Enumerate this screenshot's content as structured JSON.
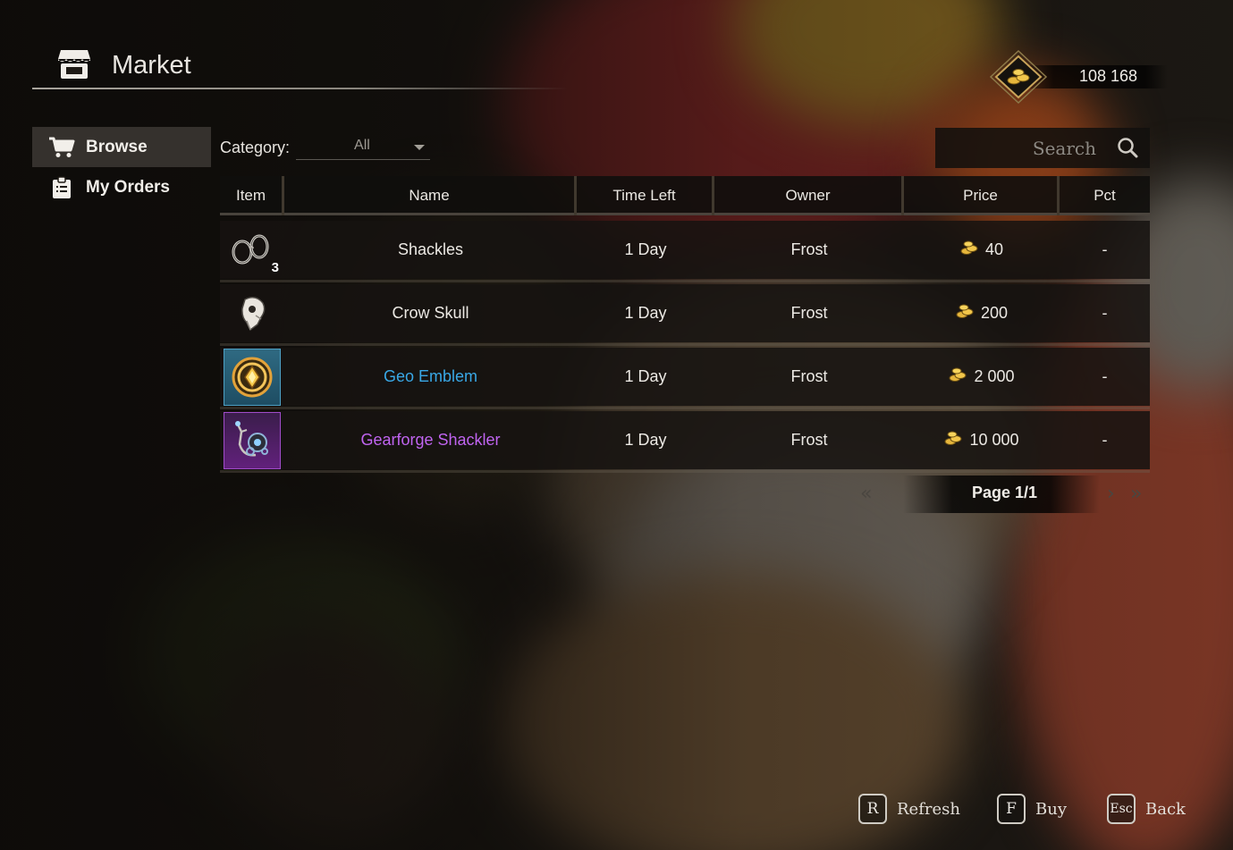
{
  "header": {
    "title": "Market",
    "icon": "market-stall-icon"
  },
  "currency": {
    "amount": "108 168",
    "icon": "gold-coins-icon"
  },
  "sidebar": {
    "items": [
      {
        "label": "Browse",
        "icon": "cart-icon",
        "active": true
      },
      {
        "label": "My Orders",
        "icon": "clipboard-icon",
        "active": false
      }
    ]
  },
  "filters": {
    "category_label": "Category:",
    "category_value": "All",
    "search_placeholder": "Search"
  },
  "table": {
    "columns": [
      "Item",
      "Name",
      "Time Left",
      "Owner",
      "Price",
      "Pct"
    ],
    "rows": [
      {
        "icon": "shackles-icon",
        "quantity": "3",
        "name": "Shackles",
        "name_color": "#ece9e4",
        "time_left": "1 Day",
        "owner": "Frost",
        "price": "40",
        "pct": "-"
      },
      {
        "icon": "crow-skull-icon",
        "quantity": "",
        "name": "Crow Skull",
        "name_color": "#ece9e4",
        "time_left": "1 Day",
        "owner": "Frost",
        "price": "200",
        "pct": "-"
      },
      {
        "icon": "geo-emblem-icon",
        "quantity": "",
        "name": "Geo Emblem",
        "name_color": "#39a8e6",
        "time_left": "1 Day",
        "owner": "Frost",
        "price": "2 000",
        "pct": "-"
      },
      {
        "icon": "gearforge-shackler-icon",
        "quantity": "",
        "name": "Gearforge Shackler",
        "name_color": "#c064f0",
        "time_left": "1 Day",
        "owner": "Frost",
        "price": "10 000",
        "pct": "-"
      }
    ]
  },
  "pagination": {
    "label": "Page 1/1"
  },
  "footer": {
    "actions": [
      {
        "key": "R",
        "label": "Refresh"
      },
      {
        "key": "F",
        "label": "Buy"
      },
      {
        "key": "Esc",
        "label": "Back"
      }
    ]
  }
}
